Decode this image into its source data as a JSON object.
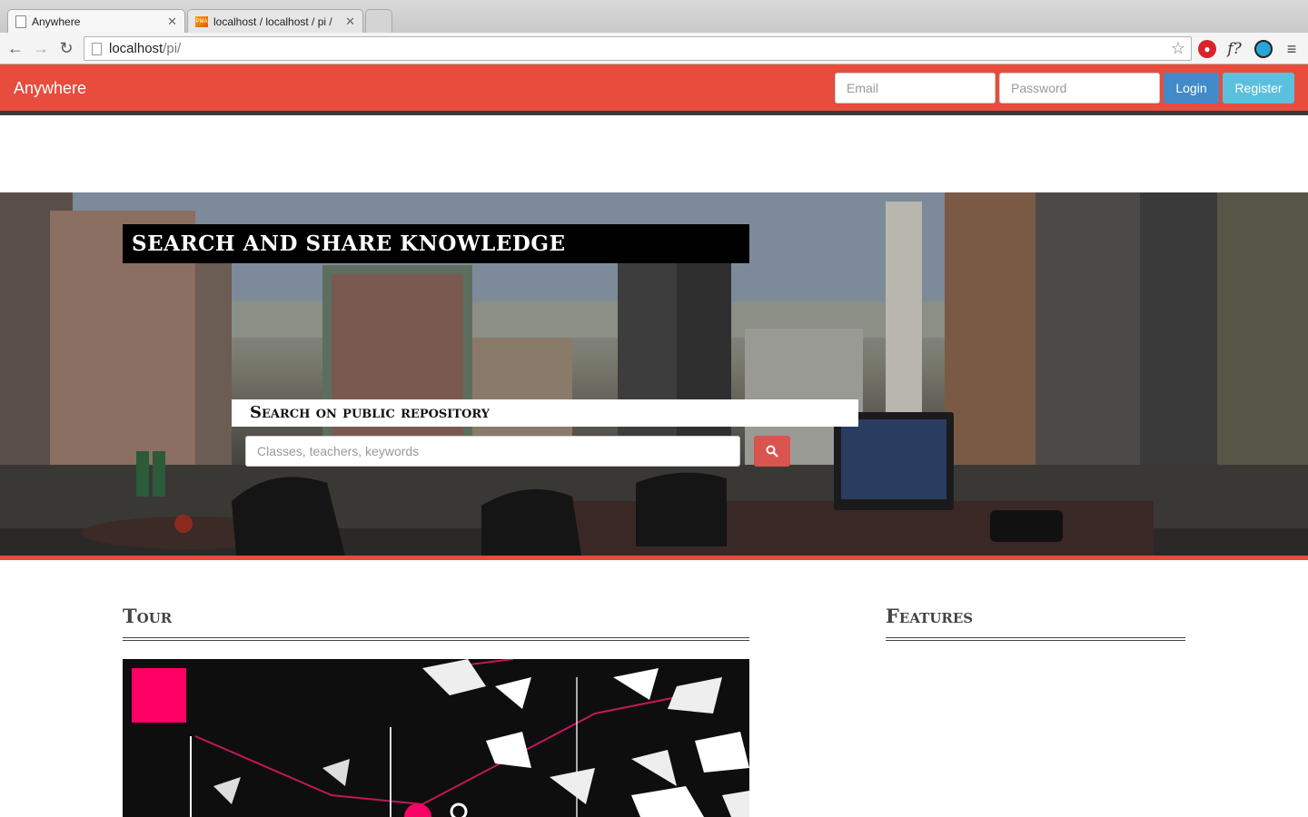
{
  "browser": {
    "tabs": [
      {
        "title": "Anywhere",
        "icon": "document-icon",
        "active": true
      },
      {
        "title": "localhost / localhost / pi /",
        "icon": "phpmyadmin-icon",
        "active": false
      }
    ],
    "url_host": "localhost",
    "url_path": "/pi/",
    "favicon_pma_text": "PMA"
  },
  "navbar": {
    "brand": "Anywhere",
    "email_placeholder": "Email",
    "password_placeholder": "Password",
    "login_label": "Login",
    "register_label": "Register",
    "accent_color": "#e74c3c"
  },
  "hero": {
    "title": "SEARCH AND SHARE KNOWLEDGE",
    "search_label": "Search on public repository",
    "search_placeholder": "Classes, teachers, keywords",
    "search_button_icon": "search-icon"
  },
  "sections": {
    "tour_title": "Tour",
    "features_title": "Features"
  }
}
